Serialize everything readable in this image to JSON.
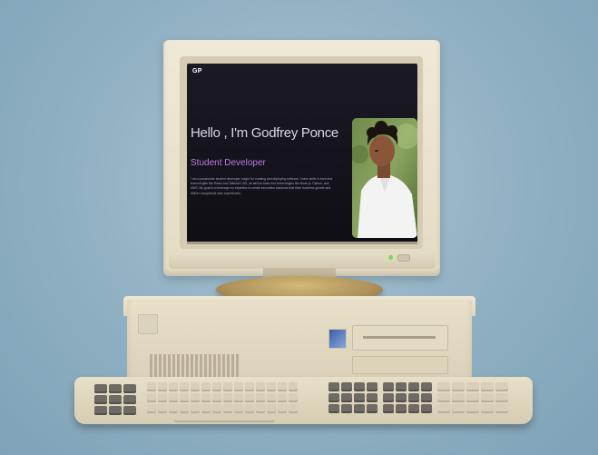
{
  "site": {
    "logo": "GP",
    "hero": {
      "title": "Hello , I'm Godfrey Ponce",
      "role": "Student Developer",
      "bio": "I am a passionate student developer, eager for creating and deploying software. I have skills in front-end technologies like React and Tailwind CSS, as well as back-end technologies like Node.js, Python, and AWS. My goal is to leverage my expertise to create innovative solutions that drive business growth and deliver exceptional user experiences."
    }
  },
  "colors": {
    "background": "#8fb0c2",
    "screen": "#15141c",
    "accent": "#c27ae8",
    "computer_beige": "#e6ddc7",
    "power_led": "#8dd06a"
  },
  "icons": {
    "power_led": "power-led-icon",
    "profile_photo": "profile-photo"
  }
}
